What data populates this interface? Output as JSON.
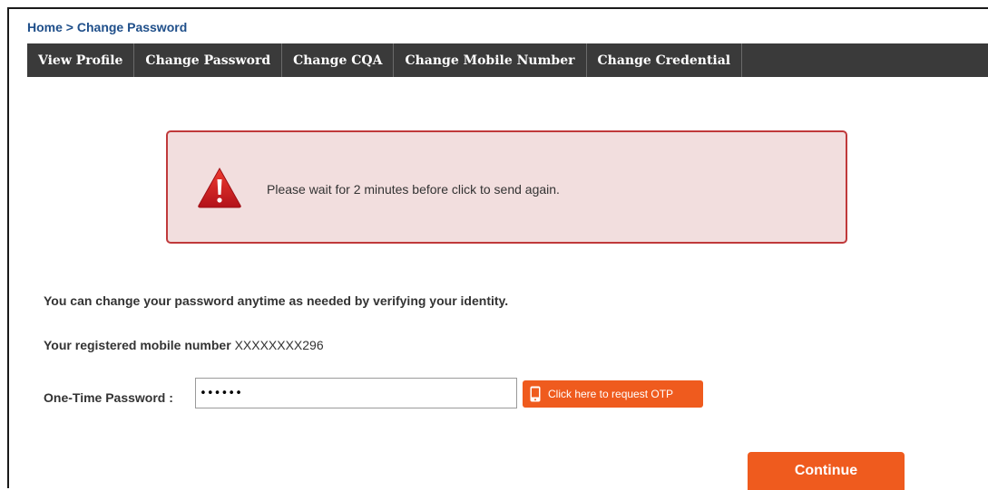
{
  "breadcrumb": {
    "home": "Home",
    "separator": ">",
    "current": "Change Password"
  },
  "tabs": [
    {
      "label": "View Profile"
    },
    {
      "label": "Change Password"
    },
    {
      "label": "Change CQA"
    },
    {
      "label": "Change Mobile Number"
    },
    {
      "label": "Change Credential"
    }
  ],
  "alert": {
    "icon": "warning-triangle-icon",
    "message": "Please wait for 2 minutes before click to send again."
  },
  "info": {
    "intro": "You can change your password anytime as needed by verifying your identity.",
    "mobile_label": "Your registered mobile number",
    "mobile_value": "XXXXXXXX296"
  },
  "otp": {
    "label": "One-Time Password :",
    "value": "••••••",
    "request_button": "Click here to request OTP",
    "request_icon": "phone-icon"
  },
  "continue_button": "Continue",
  "colors": {
    "tab_bar": "#3a3a3a",
    "accent": "#ef5b1e",
    "alert_bg": "#f2dede",
    "alert_border": "#c0393b",
    "link": "#1f4f8a"
  }
}
